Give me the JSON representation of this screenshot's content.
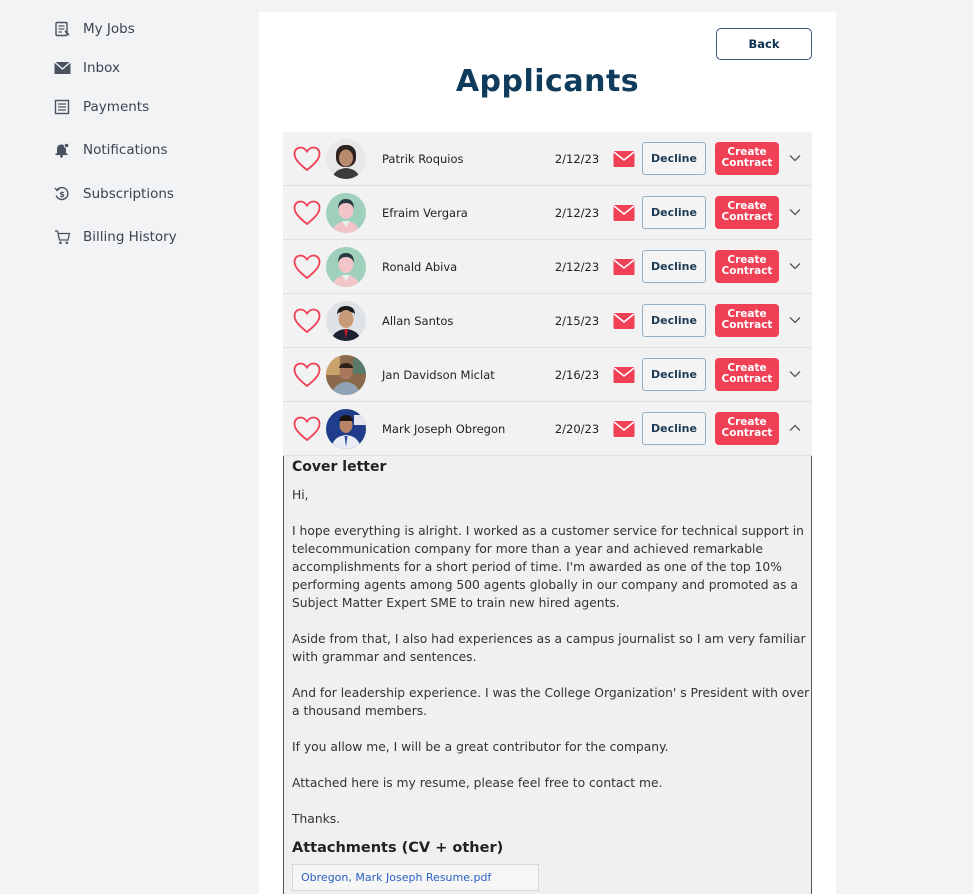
{
  "sidebar": {
    "items": [
      {
        "label": "My Jobs",
        "icon": "jobs-icon"
      },
      {
        "label": "Inbox",
        "icon": "inbox-icon"
      },
      {
        "label": "Payments",
        "icon": "payments-icon"
      },
      {
        "label": "Notifications",
        "icon": "bell-icon"
      },
      {
        "label": "Subscriptions",
        "icon": "subscription-icon"
      },
      {
        "label": "Billing History",
        "icon": "cart-icon"
      }
    ]
  },
  "header": {
    "back_label": "Back",
    "title": "Applicants"
  },
  "applicants": [
    {
      "name": "Patrik Roquios",
      "date": "2/12/23",
      "avatar": "photo"
    },
    {
      "name": "Efraim Vergara",
      "date": "2/12/23",
      "avatar": "default"
    },
    {
      "name": "Ronald Abiva",
      "date": "2/12/23",
      "avatar": "default"
    },
    {
      "name": "Allan Santos",
      "date": "2/15/23",
      "avatar": "photo"
    },
    {
      "name": "Jan Davidson Miclat",
      "date": "2/16/23",
      "avatar": "photo"
    },
    {
      "name": "Mark Joseph Obregon",
      "date": "2/20/23",
      "avatar": "photo"
    }
  ],
  "actions": {
    "decline_label": "Decline",
    "create_label_line1": "Create",
    "create_label_line2": "Contract"
  },
  "colors": {
    "accent": "#ef4056",
    "title": "#0f3b5c"
  },
  "cover_letter": {
    "heading": "Cover letter",
    "paragraphs": [
      "Hi,",
      "I hope everything is alright. I worked as a customer service for technical support in telecommunication company for more than a year and achieved remarkable accomplishments for a short period of time. I'm awarded as one of the top 10% performing agents among 500 agents globally in our company and promoted as a Subject Matter Expert SME to train new hired agents.",
      "Aside from that, I also had experiences as a campus journalist so I am very familiar with grammar and sentences.",
      "And for leadership experience. I was the College Organization' s President with over a thousand members.",
      "If you allow me, I will be a great contributor for the company.",
      "Attached here is my resume, please feel free to contact me.",
      "Thanks."
    ],
    "attachments_heading": "Attachments (CV + other)",
    "attachment_file": "Obregon, Mark Joseph Resume.pdf"
  }
}
